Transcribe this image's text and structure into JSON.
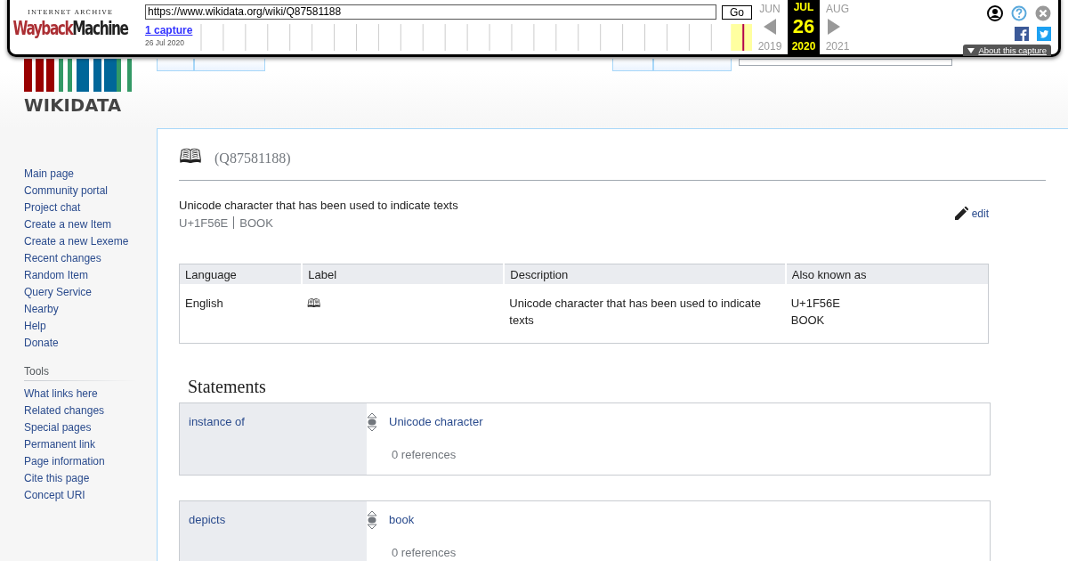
{
  "wayback": {
    "brand_top": "INTERNET ARCHIVE",
    "brand_left": "Wayback",
    "brand_right": "Machine",
    "url": "https://www.wikidata.org/wiki/Q87581188",
    "go": "Go",
    "captures": "1 capture",
    "capture_date": "26 Jul 2020",
    "months": [
      {
        "label": "JUN",
        "year": "2019",
        "selected": false
      },
      {
        "label": "JUL",
        "day": "26",
        "year": "2020",
        "selected": true
      },
      {
        "label": "AUG",
        "year": "2021",
        "selected": false
      }
    ],
    "about": "About this capture"
  },
  "logo": {
    "text": "WIKIDATA"
  },
  "sidebar": {
    "navigation": [
      "Main page",
      "Community portal",
      "Project chat",
      "Create a new Item",
      "Create a new Lexeme",
      "Recent changes",
      "Random Item",
      "Query Service",
      "Nearby",
      "Help",
      "Donate"
    ],
    "tools_heading": "Tools",
    "tools": [
      "What links here",
      "Related changes",
      "Special pages",
      "Permanent link",
      "Page information",
      "Cite this page",
      "Concept URI"
    ]
  },
  "item": {
    "label": "🕮",
    "id": "(Q87581188)",
    "description": "Unicode character that has been used to indicate texts",
    "aliases": [
      "U+1F56E",
      "BOOK"
    ],
    "edit": "edit"
  },
  "terms_table": {
    "columns": [
      "Language",
      "Label",
      "Description",
      "Also known as"
    ],
    "rows": [
      {
        "language": "English",
        "label": "🕮",
        "description": "Unicode character that has been used to indicate texts",
        "also_known_as": [
          "U+1F56E",
          "BOOK"
        ]
      }
    ]
  },
  "statements": {
    "heading": "Statements",
    "items": [
      {
        "property": "instance of",
        "value": "Unicode character",
        "references": "0 references"
      },
      {
        "property": "depicts",
        "value": "book",
        "references": "0 references"
      }
    ]
  }
}
